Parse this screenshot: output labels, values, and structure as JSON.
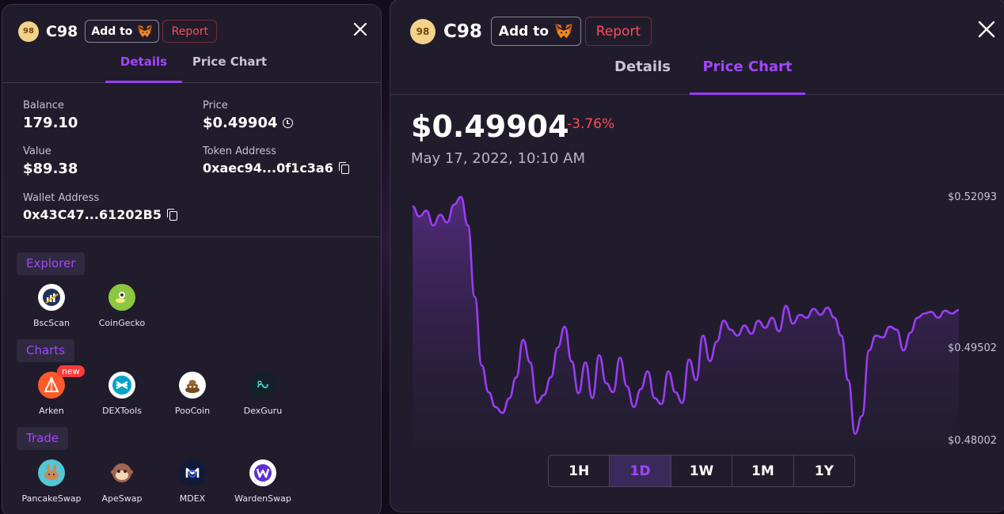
{
  "left": {
    "coin": "C98",
    "add_label": "Add to",
    "report_label": "Report",
    "tabs": [
      {
        "label": "Details"
      },
      {
        "label": "Price Chart"
      }
    ],
    "balance_label": "Balance",
    "balance_value": "179.10",
    "price_label": "Price",
    "price_value": "$0.49904",
    "value_label": "Value",
    "value_value": "$89.38",
    "token_label": "Token Address",
    "token_value": "0xaec94...0f1c3a6",
    "wallet_label": "Wallet Address",
    "wallet_value": "0x43C47...61202B5",
    "sections": {
      "explorer": {
        "label": "Explorer",
        "items": [
          {
            "label": "BscScan"
          },
          {
            "label": "CoinGecko"
          }
        ]
      },
      "charts": {
        "label": "Charts",
        "items": [
          {
            "label": "Arken"
          },
          {
            "label": "DEXTools"
          },
          {
            "label": "PooCoin"
          },
          {
            "label": "DexGuru"
          }
        ]
      },
      "trade": {
        "label": "Trade",
        "items": [
          {
            "label": "PancakeSwap"
          },
          {
            "label": "ApeSwap"
          },
          {
            "label": "MDEX"
          },
          {
            "label": "WardenSwap"
          }
        ]
      }
    },
    "new_badge": "new"
  },
  "right": {
    "coin": "C98",
    "add_label": "Add to",
    "report_label": "Report",
    "tabs": [
      {
        "label": "Details"
      },
      {
        "label": "Price Chart"
      }
    ],
    "price": "$0.49904",
    "change": "-3.76%",
    "date": "May 17, 2022, 10:10 AM",
    "ranges": [
      {
        "label": "1H"
      },
      {
        "label": "1D"
      },
      {
        "label": "1W"
      },
      {
        "label": "1M"
      },
      {
        "label": "1Y"
      }
    ],
    "active_range": "1D"
  },
  "colors": {
    "accent": "#9b3cf5",
    "negative": "#ff4d5a",
    "panel": "#201c2b"
  },
  "chart_data": {
    "type": "area",
    "title": "",
    "ylim": [
      0.48002,
      0.52093
    ],
    "y_ticks": [
      "$0.52093",
      "$0.49502",
      "$0.48002"
    ],
    "y_tick_values": [
      0.52093,
      0.49502,
      0.48002
    ],
    "x": [
      0,
      1,
      2,
      3,
      4,
      5,
      6,
      7,
      8,
      9,
      10,
      11,
      12,
      13,
      14,
      15,
      16,
      17,
      18,
      19,
      20,
      21,
      22,
      23,
      24,
      25,
      26,
      27,
      28,
      29,
      30,
      31,
      32,
      33,
      34,
      35,
      36,
      37,
      38,
      39,
      40,
      41,
      42,
      43,
      44,
      45,
      46,
      47,
      48,
      49,
      50,
      51,
      52,
      53,
      54,
      55,
      56,
      57,
      58,
      59,
      60,
      61,
      62,
      63,
      64,
      65,
      66,
      67,
      68,
      69,
      70,
      71,
      72,
      73,
      74,
      75,
      76,
      77,
      78,
      79
    ],
    "values": [
      0.5192,
      0.5175,
      0.5185,
      0.516,
      0.5178,
      0.5165,
      0.5195,
      0.5208,
      0.516,
      0.504,
      0.4925,
      0.488,
      0.4855,
      0.4845,
      0.487,
      0.4905,
      0.4968,
      0.493,
      0.4862,
      0.4875,
      0.4905,
      0.4955,
      0.499,
      0.4932,
      0.4878,
      0.493,
      0.487,
      0.4942,
      0.4895,
      0.488,
      0.4938,
      0.489,
      0.4855,
      0.4885,
      0.4915,
      0.487,
      0.486,
      0.4915,
      0.488,
      0.4862,
      0.4935,
      0.49,
      0.4975,
      0.4932,
      0.4965,
      0.5,
      0.4985,
      0.4975,
      0.4992,
      0.4978,
      0.5,
      0.4988,
      0.5005,
      0.4982,
      0.5025,
      0.4995,
      0.501,
      0.5005,
      0.502,
      0.501,
      0.5022,
      0.5005,
      0.4975,
      0.49,
      0.481,
      0.484,
      0.495,
      0.4975,
      0.4972,
      0.499,
      0.4985,
      0.495,
      0.498,
      0.5005,
      0.5012,
      0.5015,
      0.5005,
      0.5017,
      0.5012,
      0.5018
    ]
  }
}
